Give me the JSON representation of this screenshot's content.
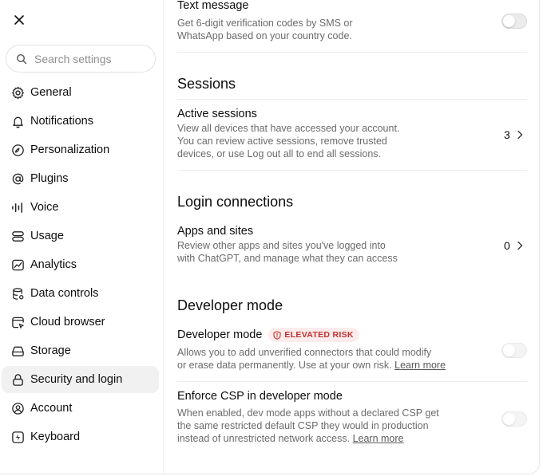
{
  "sidebar": {
    "search_placeholder": "Search settings",
    "items": [
      {
        "label": "General",
        "icon": "gear-icon"
      },
      {
        "label": "Notifications",
        "icon": "bell-icon"
      },
      {
        "label": "Personalization",
        "icon": "personalization-icon"
      },
      {
        "label": "Plugins",
        "icon": "at-icon"
      },
      {
        "label": "Voice",
        "icon": "waveform-icon"
      },
      {
        "label": "Usage",
        "icon": "usage-icon"
      },
      {
        "label": "Analytics",
        "icon": "chart-icon"
      },
      {
        "label": "Data controls",
        "icon": "database-icon"
      },
      {
        "label": "Cloud browser",
        "icon": "browser-icon"
      },
      {
        "label": "Storage",
        "icon": "storage-icon"
      },
      {
        "label": "Security and login",
        "icon": "lock-icon",
        "active": true
      },
      {
        "label": "Account",
        "icon": "user-icon"
      },
      {
        "label": "Keyboard",
        "icon": "keyboard-icon"
      }
    ]
  },
  "main": {
    "text_message": {
      "title": "Text message",
      "desc1": "Get 6-digit verification codes by SMS or",
      "desc2": "WhatsApp based on your country code."
    },
    "sessions": {
      "heading": "Sessions",
      "title": "Active sessions",
      "desc1": "View all devices that have accessed your account.",
      "desc2": "You can review active sessions, remove trusted",
      "desc3": "devices, or use Log out all to end all sessions.",
      "count": "3"
    },
    "login_connections": {
      "heading": "Login connections",
      "title": "Apps and sites",
      "desc1": "Review other apps and sites you've logged into",
      "desc2": "with ChatGPT, and manage what they can access",
      "count": "0"
    },
    "developer": {
      "heading": "Developer mode",
      "title": "Developer mode",
      "badge": "ELEVATED RISK",
      "desc1": "Allows you to add unverified connectors that could modify",
      "desc2_prefix": "or erase data permanently. Use at your own risk. ",
      "learn_more": "Learn more",
      "csp_title": "Enforce CSP in developer mode",
      "csp_desc1": "When enabled, dev mode apps without a declared CSP get",
      "csp_desc2": "the same restricted default CSP they would in production",
      "csp_desc3_prefix": "instead of unrestricted network access. ",
      "csp_learn_more": "Learn more"
    }
  },
  "colors": {
    "badge_bg": "#fdecec",
    "badge_text": "#c22f2f",
    "active_nav": "#f1f1f1"
  }
}
